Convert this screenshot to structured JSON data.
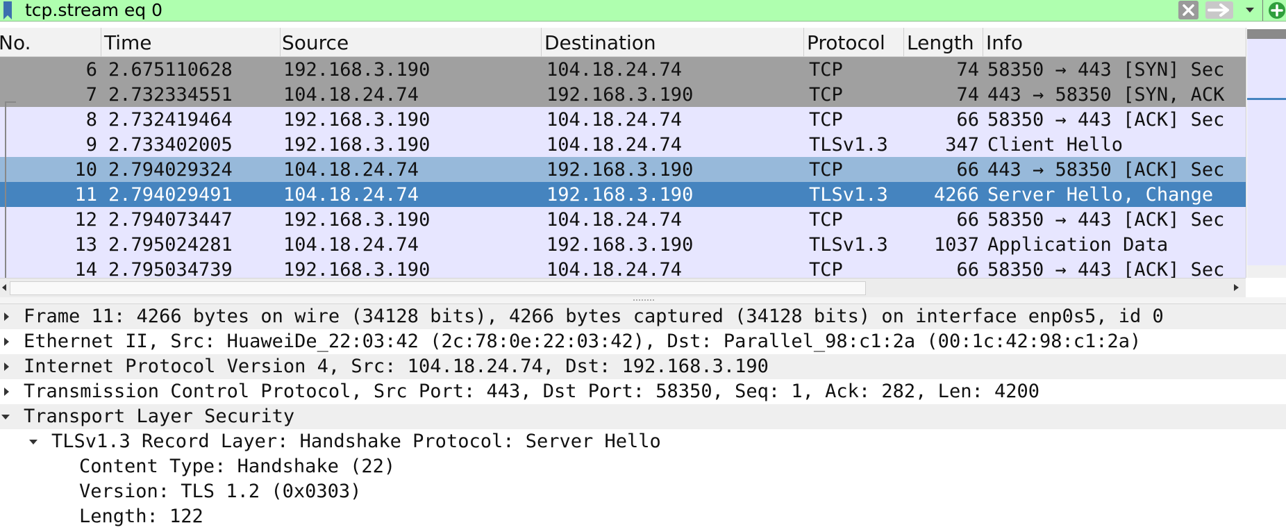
{
  "filter": {
    "expression": "tcp.stream eq 0"
  },
  "columns": {
    "no": "No.",
    "time": "Time",
    "source": "Source",
    "destination": "Destination",
    "protocol": "Protocol",
    "length": "Length",
    "info": "Info"
  },
  "packets": [
    {
      "no": "6",
      "time": "2.675110628",
      "source": "192.168.3.190",
      "destination": "104.18.24.74",
      "protocol": "TCP",
      "length": "74",
      "info": "58350 → 443 [SYN] Sec"
    },
    {
      "no": "7",
      "time": "2.732334551",
      "source": "104.18.24.74",
      "destination": "192.168.3.190",
      "protocol": "TCP",
      "length": "74",
      "info": "443 → 58350 [SYN, ACK"
    },
    {
      "no": "8",
      "time": "2.732419464",
      "source": "192.168.3.190",
      "destination": "104.18.24.74",
      "protocol": "TCP",
      "length": "66",
      "info": "58350 → 443 [ACK] Sec"
    },
    {
      "no": "9",
      "time": "2.733402005",
      "source": "192.168.3.190",
      "destination": "104.18.24.74",
      "protocol": "TLSv1.3",
      "length": "347",
      "info": "Client Hello"
    },
    {
      "no": "10",
      "time": "2.794029324",
      "source": "104.18.24.74",
      "destination": "192.168.3.190",
      "protocol": "TCP",
      "length": "66",
      "info": "443 → 58350 [ACK] Sec"
    },
    {
      "no": "11",
      "time": "2.794029491",
      "source": "104.18.24.74",
      "destination": "192.168.3.190",
      "protocol": "TLSv1.3",
      "length": "4266",
      "info": "Server Hello, Change"
    },
    {
      "no": "12",
      "time": "2.794073447",
      "source": "192.168.3.190",
      "destination": "104.18.24.74",
      "protocol": "TCP",
      "length": "66",
      "info": "58350 → 443 [ACK] Sec"
    },
    {
      "no": "13",
      "time": "2.795024281",
      "source": "104.18.24.74",
      "destination": "192.168.3.190",
      "protocol": "TLSv1.3",
      "length": "1037",
      "info": "Application Data"
    },
    {
      "no": "14",
      "time": "2.795034739",
      "source": "192.168.3.190",
      "destination": "104.18.24.74",
      "protocol": "TCP",
      "length": "66",
      "info": "58350 → 443 [ACK] Sec"
    }
  ],
  "row_colors": {
    "syn": "#a0a0a0",
    "normal": "#e7e6ff",
    "related": "#97b9da",
    "selected": "#4584bf",
    "filter_valid": "#afffaf"
  },
  "details": {
    "frame": "Frame 11: 4266 bytes on wire (34128 bits), 4266 bytes captured (34128 bits) on interface enp0s5, id 0",
    "ethernet": "Ethernet II, Src: HuaweiDe_22:03:42 (2c:78:0e:22:03:42), Dst: Parallel_98:c1:2a (00:1c:42:98:c1:2a)",
    "ip": "Internet Protocol Version 4, Src: 104.18.24.74, Dst: 192.168.3.190",
    "tcp": "Transmission Control Protocol, Src Port: 443, Dst Port: 58350, Seq: 1, Ack: 282, Len: 4200",
    "tls": "Transport Layer Security",
    "tls_record": "TLSv1.3 Record Layer: Handshake Protocol: Server Hello",
    "content_type": "Content Type: Handshake (22)",
    "version": "Version: TLS 1.2 (0x0303)",
    "length": "Length: 122"
  },
  "icons": {
    "bookmark": "bookmark-icon",
    "clear": "clear-filter-icon",
    "apply": "apply-filter-arrow-icon",
    "history": "filter-history-dropdown-icon",
    "add": "add-filter-button-icon"
  }
}
